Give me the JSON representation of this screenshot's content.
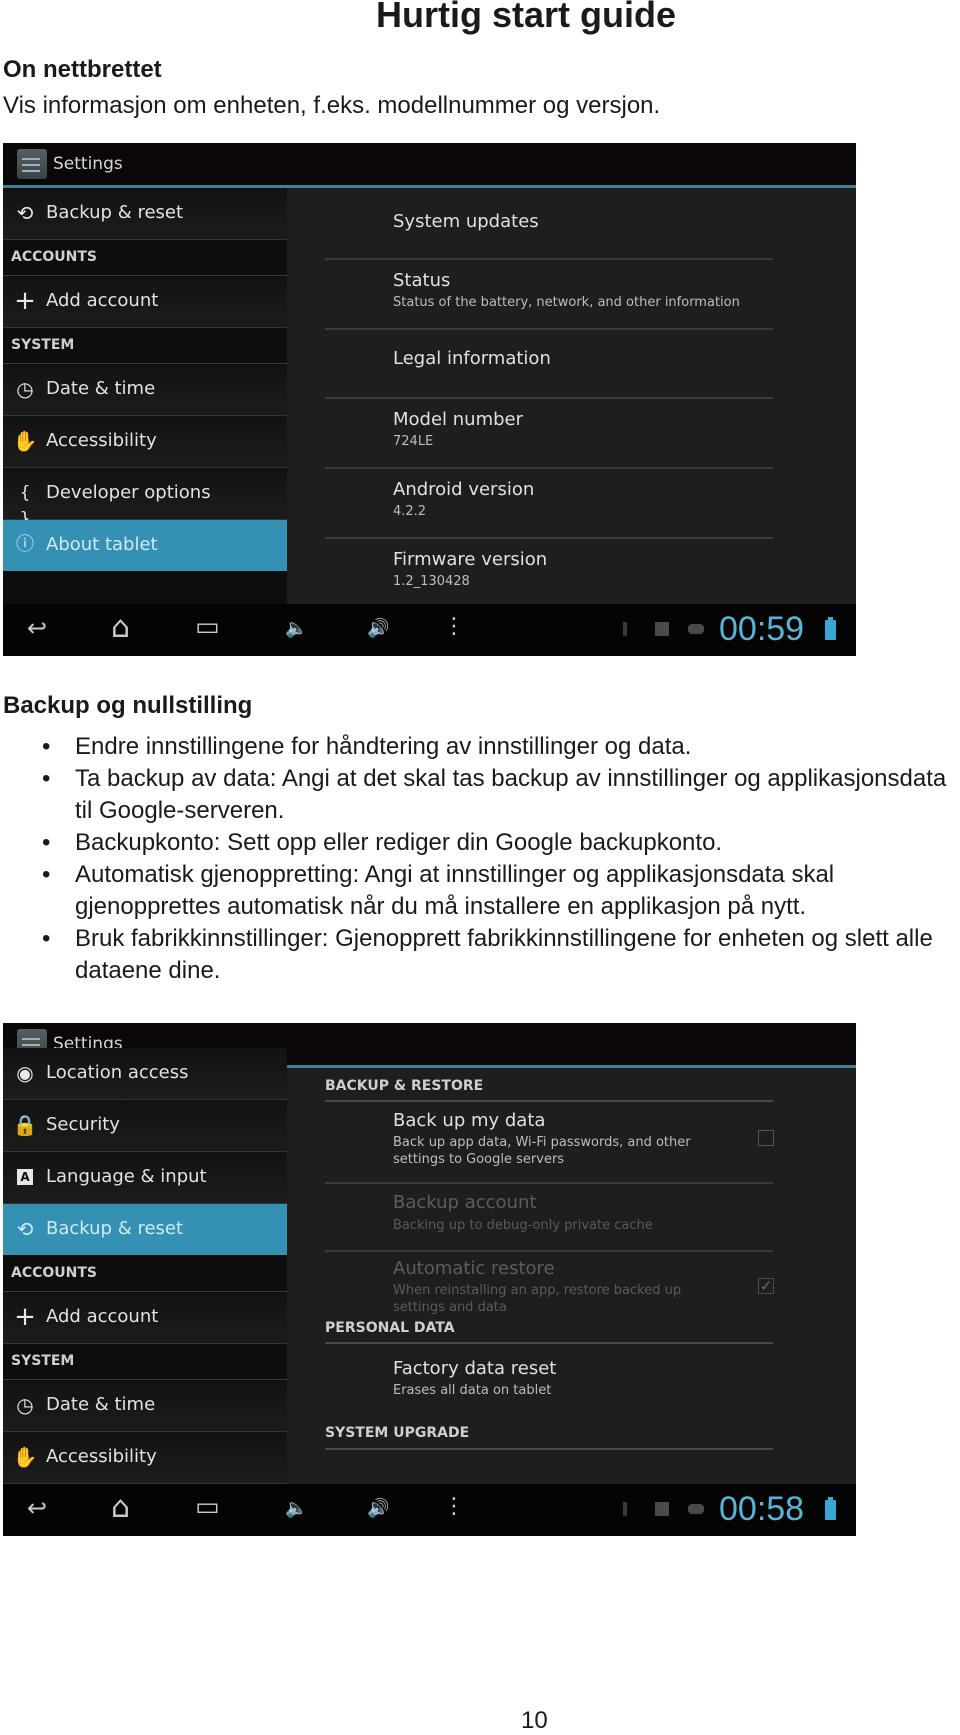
{
  "document": {
    "title": "Hurtig start guide",
    "page_number": "10"
  },
  "section_about": {
    "heading": "On nettbrettet",
    "description": "Vis informasjon om enheten, f.eks. modellnummer og versjon."
  },
  "screenshot_about": {
    "app_title": "Settings",
    "sidebar": [
      {
        "type": "item",
        "icon": "backup-reset-icon",
        "label": "Backup & reset"
      },
      {
        "type": "category",
        "label": "ACCOUNTS"
      },
      {
        "type": "item",
        "icon": "plus-icon",
        "label": "Add account"
      },
      {
        "type": "category",
        "label": "SYSTEM"
      },
      {
        "type": "item",
        "icon": "clock-icon",
        "label": "Date & time"
      },
      {
        "type": "item",
        "icon": "hand-icon",
        "label": "Accessibility"
      },
      {
        "type": "item",
        "icon": "braces-icon",
        "label": "Developer options"
      },
      {
        "type": "item",
        "icon": "info-icon",
        "label": "About tablet",
        "active": true
      }
    ],
    "prefs": [
      {
        "title": "System updates",
        "summary": ""
      },
      {
        "title": "Status",
        "summary": "Status of the battery, network, and other information"
      },
      {
        "title": "Legal information",
        "summary": ""
      },
      {
        "title": "Model number",
        "summary": "724LE"
      },
      {
        "title": "Android version",
        "summary": "4.2.2"
      },
      {
        "title": "Firmware version",
        "summary": "1.2_130428"
      }
    ],
    "clock": "00:59"
  },
  "section_backup": {
    "heading": "Backup og nullstilling",
    "bullets": [
      "Endre innstillingene for håndtering av innstillinger og data.",
      "Ta backup av data: Angi at det skal tas backup av innstillinger og applikasjonsdata til Google-serveren.",
      "Backupkonto: Sett opp eller rediger din Google backupkonto.",
      "Automatisk gjenoppretting: Angi at innstillinger og applikasjonsdata skal gjenopprettes automatisk når du må installere en applikasjon på nytt.",
      "Bruk fabrikkinnstillinger: Gjenopprett fabrikkinnstillingene for enheten og slett alle dataene dine."
    ],
    "bullet_glyph": "•"
  },
  "screenshot_backup": {
    "app_title": "Settings",
    "sidebar": [
      {
        "type": "item",
        "icon": "location-icon",
        "label": "Location access"
      },
      {
        "type": "item",
        "icon": "lock-icon",
        "label": "Security"
      },
      {
        "type": "item",
        "icon": "keyboard-a-icon",
        "label": "Language & input"
      },
      {
        "type": "item",
        "icon": "backup-reset-icon",
        "label": "Backup & reset",
        "active": true
      },
      {
        "type": "category",
        "label": "ACCOUNTS"
      },
      {
        "type": "item",
        "icon": "plus-icon",
        "label": "Add account"
      },
      {
        "type": "category",
        "label": "SYSTEM"
      },
      {
        "type": "item",
        "icon": "clock-icon",
        "label": "Date & time"
      },
      {
        "type": "item",
        "icon": "hand-icon",
        "label": "Accessibility"
      }
    ],
    "categories": {
      "backup_restore": "BACKUP & RESTORE",
      "personal_data": "PERSONAL DATA",
      "system_upgrade": "SYSTEM UPGRADE"
    },
    "prefs": {
      "backup_my_data": {
        "title": "Back up my data",
        "summary": "Back up app data, Wi-Fi passwords, and other settings to Google servers",
        "checked": false
      },
      "backup_account": {
        "title": "Backup account",
        "summary": "Backing up to debug-only private cache",
        "enabled": false
      },
      "automatic_restore": {
        "title": "Automatic restore",
        "summary": "When reinstalling an app, restore backed up settings and data",
        "checked": true,
        "enabled": false
      },
      "factory_reset": {
        "title": "Factory data reset",
        "summary": "Erases all data on tablet"
      }
    },
    "clock": "00:58"
  },
  "navbar_icons": {
    "back": "↩",
    "home": "⌂",
    "recents": "▭",
    "vol_down": "🔈",
    "vol_up": "🔊",
    "menu": "⋮",
    "checkmark": "✓"
  },
  "colors": {
    "accent": "#3591b4",
    "clock": "#58b5d8",
    "actionbar_border": "#3e7f96"
  }
}
